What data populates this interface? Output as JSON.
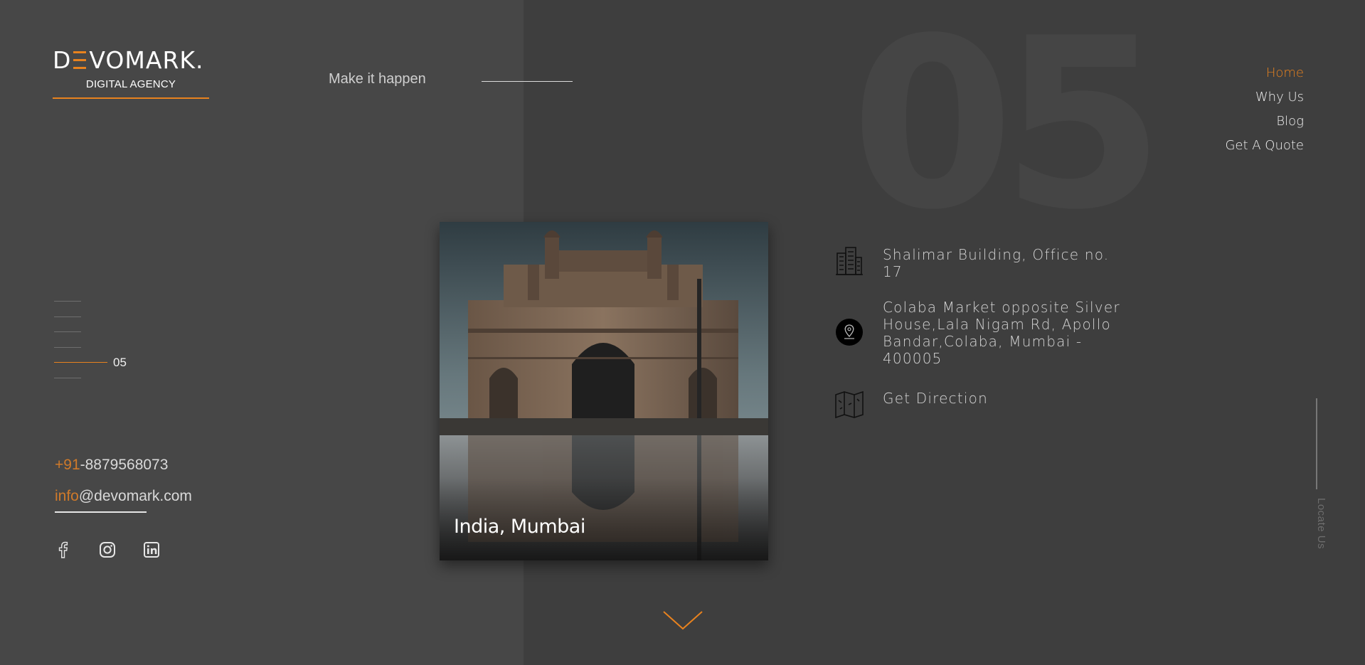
{
  "brand": {
    "logo_left": "D",
    "logo_right": "VOMARK.",
    "logo_sub": "DIGITAL AGENCY",
    "accent_color": "#e8821e"
  },
  "header": {
    "tagline": "Make it happen",
    "big_number": "05"
  },
  "nav": {
    "items": [
      {
        "label": "Home",
        "active": true
      },
      {
        "label": "Why Us",
        "active": false
      },
      {
        "label": "Blog",
        "active": false
      },
      {
        "label": "Get A Quote",
        "active": false
      }
    ]
  },
  "pager": {
    "current": "05",
    "total_lines": 6,
    "active_index": 4
  },
  "contact": {
    "phone_prefix": "+91",
    "phone_number": "-8879568073",
    "email_user": "info",
    "email_domain": "@devomark.com"
  },
  "social": {
    "icons": [
      "facebook-icon",
      "instagram-icon",
      "linkedin-icon"
    ]
  },
  "card": {
    "caption": "India, Mumbai"
  },
  "info": {
    "building": "Shalimar Building, Office no. 17",
    "address": "Colaba Market opposite Silver House,Lala Nigam Rd, Apollo Bandar,Colaba, Mumbai - 400005",
    "direction": "Get Direction",
    "icons": [
      "building-icon",
      "location-pin-icon",
      "map-icon"
    ]
  },
  "side": {
    "locate_label": "Locate Us"
  },
  "scroll": {
    "icon": "chevron-down-icon"
  }
}
